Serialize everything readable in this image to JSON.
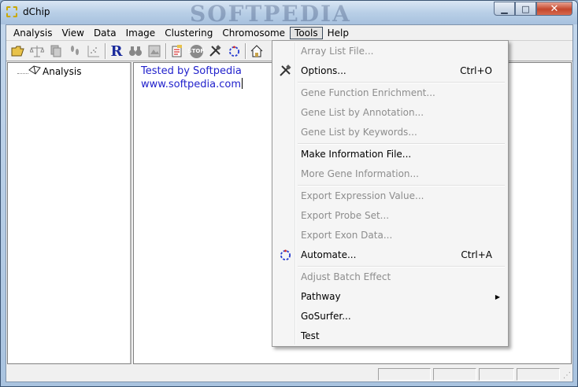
{
  "window": {
    "title": "dChip",
    "watermark": "SOFTPEDIA",
    "minimize_glyph": "▁",
    "maximize_glyph": "□",
    "close_glyph": "✕"
  },
  "menubar": {
    "items": [
      "Analysis",
      "View",
      "Data",
      "Image",
      "Clustering",
      "Chromosome",
      "Tools",
      "Help"
    ],
    "active": "Tools"
  },
  "toolbar": {
    "icons": [
      "open-folder-icon",
      "balance-icon",
      "copy-icon",
      "footprints-icon",
      "scatter-icon",
      "r-icon",
      "binoculars-icon",
      "image-icon",
      "notes-icon",
      "stop-icon",
      "tools-icon",
      "automate-icon",
      "home-icon"
    ],
    "r_glyph": "R",
    "stop_glyph": "STOP"
  },
  "tree": {
    "items": [
      {
        "label": "Analysis",
        "icon": "analysis-node-icon"
      }
    ]
  },
  "content": {
    "line1": "Tested by Softpedia",
    "line2": "www.softpedia.com"
  },
  "tools_menu": {
    "items": [
      {
        "label": "Array List File...",
        "shortcut": "",
        "enabled": false,
        "icon": ""
      },
      {
        "label": "Options...",
        "shortcut": "Ctrl+O",
        "enabled": true,
        "icon": "tools-icon"
      },
      {
        "label": "Gene Function Enrichment...",
        "shortcut": "",
        "enabled": false,
        "icon": ""
      },
      {
        "label": "Gene List by Annotation...",
        "shortcut": "",
        "enabled": false,
        "icon": ""
      },
      {
        "label": "Gene List by Keywords...",
        "shortcut": "",
        "enabled": false,
        "icon": ""
      },
      {
        "label": "Make Information File...",
        "shortcut": "",
        "enabled": true,
        "icon": ""
      },
      {
        "label": "More Gene Information...",
        "shortcut": "",
        "enabled": false,
        "icon": ""
      },
      {
        "label": "Export Expression Value...",
        "shortcut": "",
        "enabled": false,
        "icon": ""
      },
      {
        "label": "Export Probe Set...",
        "shortcut": "",
        "enabled": false,
        "icon": ""
      },
      {
        "label": "Export Exon Data...",
        "shortcut": "",
        "enabled": false,
        "icon": ""
      },
      {
        "label": "Automate...",
        "shortcut": "Ctrl+A",
        "enabled": true,
        "icon": "automate-icon"
      },
      {
        "label": "Adjust Batch Effect",
        "shortcut": "",
        "enabled": false,
        "icon": ""
      },
      {
        "label": "Pathway",
        "shortcut": "",
        "enabled": true,
        "icon": "",
        "submenu": true
      },
      {
        "label": "GoSurfer...",
        "shortcut": "",
        "enabled": true,
        "icon": ""
      },
      {
        "label": "Test",
        "shortcut": "",
        "enabled": true,
        "icon": ""
      }
    ],
    "submenu_glyph": "▶"
  },
  "colors": {
    "link_text": "#2222cc",
    "disabled_text": "#8d8d8d",
    "close_button": "#c4472c"
  }
}
